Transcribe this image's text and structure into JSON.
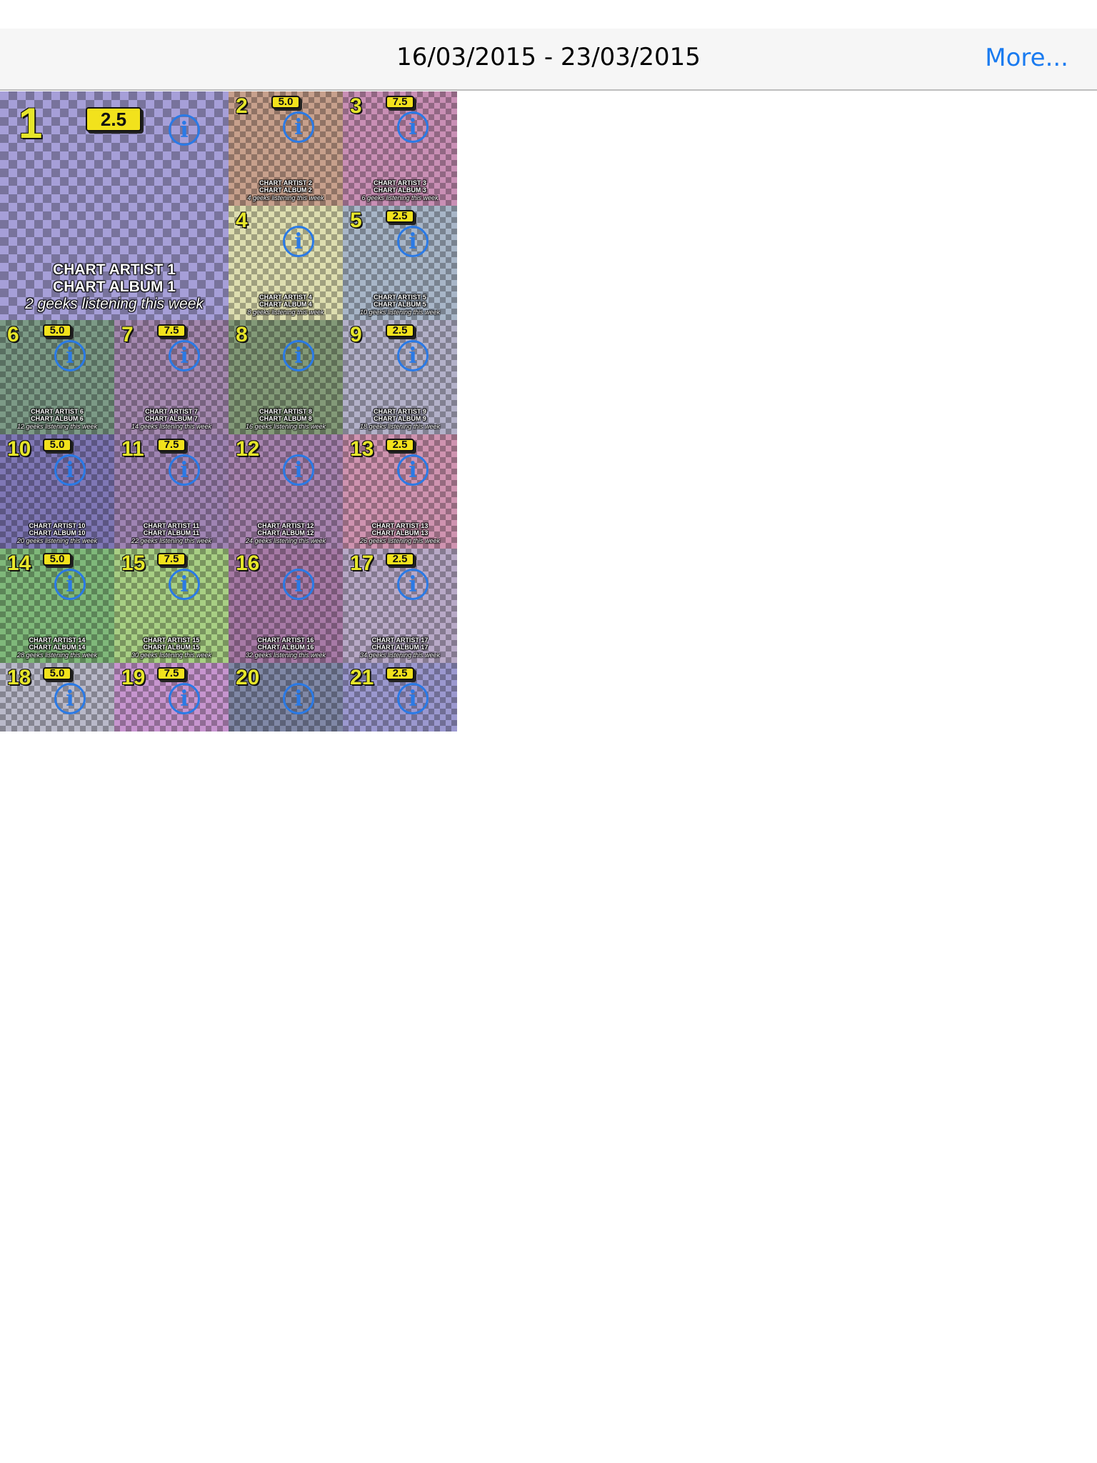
{
  "nav": {
    "title": "16/03/2015 - 23/03/2015",
    "more_label": "More..."
  },
  "tiles": [
    {
      "rank": "1",
      "badge": "2.5",
      "artist": "CHART ARTIST 1",
      "album": "CHART ALBUM 1",
      "listeners": "2 geeks listening this week",
      "tint": "#a69fd8"
    },
    {
      "rank": "2",
      "badge": "5.0",
      "artist": "CHART ARTIST 2",
      "album": "CHART ALBUM 2",
      "listeners": "4 geeks listening this week",
      "tint": "#c7a08c"
    },
    {
      "rank": "3",
      "badge": "7.5",
      "artist": "CHART ARTIST 3",
      "album": "CHART ALBUM 3",
      "listeners": "6 geeks listening this week",
      "tint": "#c98fb5"
    },
    {
      "rank": "4",
      "badge": "",
      "artist": "CHART ARTIST 4",
      "album": "CHART ALBUM 4",
      "listeners": "8 geeks listening this week",
      "tint": "#dedeb0"
    },
    {
      "rank": "5",
      "badge": "2.5",
      "artist": "CHART ARTIST 5",
      "album": "CHART ALBUM 5",
      "listeners": "10 geeks listening this week",
      "tint": "#a8b6c8"
    },
    {
      "rank": "6",
      "badge": "5.0",
      "artist": "CHART ARTIST 6",
      "album": "CHART ALBUM 6",
      "listeners": "12 geeks listening this week",
      "tint": "#7c9a86"
    },
    {
      "rank": "7",
      "badge": "7.5",
      "artist": "CHART ARTIST 7",
      "album": "CHART ALBUM 7",
      "listeners": "14 geeks listening this week",
      "tint": "#a589b0"
    },
    {
      "rank": "8",
      "badge": "",
      "artist": "CHART ARTIST 8",
      "album": "CHART ALBUM 8",
      "listeners": "16 geeks listening this week",
      "tint": "#839a78"
    },
    {
      "rank": "9",
      "badge": "2.5",
      "artist": "CHART ARTIST 9",
      "album": "CHART ALBUM 9",
      "listeners": "18 geeks listening this week",
      "tint": "#b3b1c9"
    },
    {
      "rank": "10",
      "badge": "5.0",
      "artist": "CHART ARTIST 10",
      "album": "CHART ALBUM 10",
      "listeners": "20 geeks listening this week",
      "tint": "#7f77b5"
    },
    {
      "rank": "11",
      "badge": "7.5",
      "artist": "CHART ARTIST 11",
      "album": "CHART ALBUM 11",
      "listeners": "22 geeks listening this week",
      "tint": "#9f84b3"
    },
    {
      "rank": "12",
      "badge": "",
      "artist": "CHART ARTIST 12",
      "album": "CHART ALBUM 12",
      "listeners": "24 geeks listening this week",
      "tint": "#a884b0"
    },
    {
      "rank": "13",
      "badge": "2.5",
      "artist": "CHART ARTIST 13",
      "album": "CHART ALBUM 13",
      "listeners": "26 geeks listening this week",
      "tint": "#cf93b0"
    },
    {
      "rank": "14",
      "badge": "5.0",
      "artist": "CHART ARTIST 14",
      "album": "CHART ALBUM 14",
      "listeners": "28 geeks listening this week",
      "tint": "#7fb87a"
    },
    {
      "rank": "15",
      "badge": "7.5",
      "artist": "CHART ARTIST 15",
      "album": "CHART ALBUM 15",
      "listeners": "30 geeks listening this week",
      "tint": "#a8cf84"
    },
    {
      "rank": "16",
      "badge": "",
      "artist": "CHART ARTIST 16",
      "album": "CHART ALBUM 16",
      "listeners": "32 geeks listening this week",
      "tint": "#a77aa6"
    },
    {
      "rank": "17",
      "badge": "2.5",
      "artist": "CHART ARTIST 17",
      "album": "CHART ALBUM 17",
      "listeners": "34 geeks listening this week",
      "tint": "#b8a9c7"
    },
    {
      "rank": "18",
      "badge": "5.0",
      "artist": "",
      "album": "",
      "listeners": "",
      "tint": "#b9b9c9"
    },
    {
      "rank": "19",
      "badge": "7.5",
      "artist": "",
      "album": "",
      "listeners": "",
      "tint": "#c795cf"
    },
    {
      "rank": "20",
      "badge": "",
      "artist": "",
      "album": "",
      "listeners": "",
      "tint": "#8088a6"
    },
    {
      "rank": "21",
      "badge": "2.5",
      "artist": "",
      "album": "",
      "listeners": "",
      "tint": "#9b98cf"
    }
  ]
}
